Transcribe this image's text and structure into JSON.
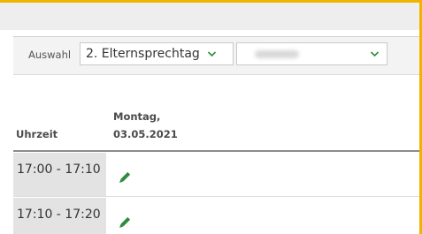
{
  "toolbar": {
    "label": "Auswahl",
    "select_event_value": "2. Elternsprechtag",
    "select_teacher_value": "",
    "icons": {
      "dropdown": "chevron-down-icon"
    }
  },
  "table": {
    "time_header": "Uhrzeit",
    "day_header_line1": "Montag,",
    "day_header_line2": "03.05.2021",
    "rows": [
      {
        "time": "17:00 - 17:10",
        "action_icon": "pencil-icon"
      },
      {
        "time": "17:10 - 17:20",
        "action_icon": "pencil-icon"
      }
    ]
  },
  "colors": {
    "accent_border": "#f0b400",
    "icon_green": "#2e8b3d",
    "time_cell_bg": "#e3e3e3"
  }
}
